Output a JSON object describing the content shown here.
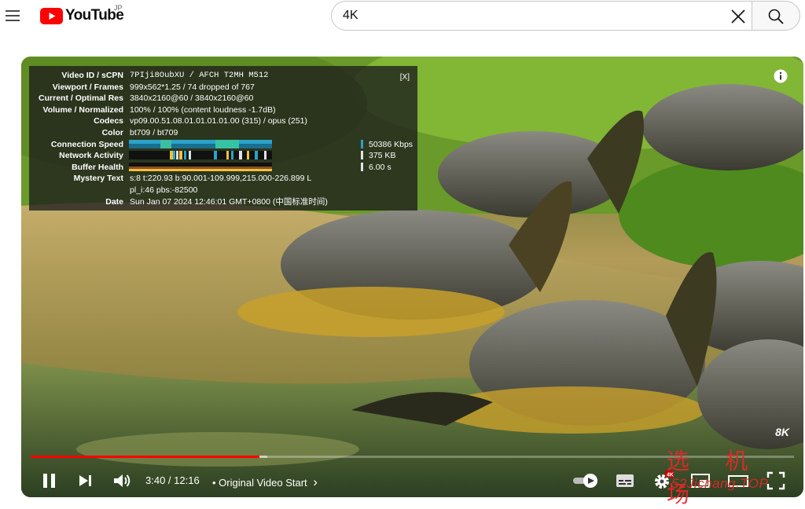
{
  "header": {
    "logo_text": "YouTube",
    "logo_region": "JP",
    "search_value": "4K"
  },
  "stats_panel": {
    "close_label": "[X]",
    "rows": [
      {
        "label": "Video ID / sCPN",
        "value": "7PIji8OubXU / AFCH T2MH M512"
      },
      {
        "label": "Viewport / Frames",
        "value": "999x562*1.25 / 74 dropped of 767"
      },
      {
        "label": "Current / Optimal Res",
        "value": "3840x2160@60 / 3840x2160@60"
      },
      {
        "label": "Volume / Normalized",
        "value": "100% / 100% (content loudness -1.7dB)"
      },
      {
        "label": "Codecs",
        "value": "vp09.00.51.08.01.01.01.01.00 (315) / opus (251)"
      },
      {
        "label": "Color",
        "value": "bt709 / bt709"
      }
    ],
    "graphs": [
      {
        "label": "Connection Speed",
        "value": "50386 Kbps",
        "color": "#2aa3c9"
      },
      {
        "label": "Network Activity",
        "value": "375 KB",
        "color": "#e2e2e2"
      },
      {
        "label": "Buffer Health",
        "value": "6.00 s",
        "color": "#e2e2e2"
      }
    ],
    "mystery_label": "Mystery Text",
    "mystery_line1": "s:8 t:220.93 b:90.001-109.999,215.000-226.899 L",
    "mystery_line2": "pl_i:46 pbs:-82500",
    "date_label": "Date",
    "date_value": "Sun Jan 07 2024 12:46:01 GMT+0800 (中国标准时间)"
  },
  "player": {
    "watermark": "8K",
    "progress_played_fraction": 0.3,
    "progress_loaded_fraction": 0.31,
    "time_display": "3:40 / 12:16",
    "chapter_label": "• Original Video Start",
    "chapter_arrow": "›",
    "quality_badge": "4K",
    "accent_color": "#ff0000"
  },
  "overlay_brand": {
    "chinese": "选 机 场",
    "url": "52Jichang.TOP"
  },
  "icons": {
    "menu": "hamburger-menu-icon",
    "clear": "close-icon",
    "search": "search-icon",
    "info": "info-icon",
    "pause": "pause-icon",
    "next": "next-icon",
    "volume": "volume-icon",
    "autoplay": "autoplay-toggle-icon",
    "subtitles": "subtitles-icon",
    "settings": "gear-icon",
    "miniplayer": "miniplayer-icon",
    "theater": "theater-icon",
    "fullscreen": "fullscreen-icon"
  }
}
